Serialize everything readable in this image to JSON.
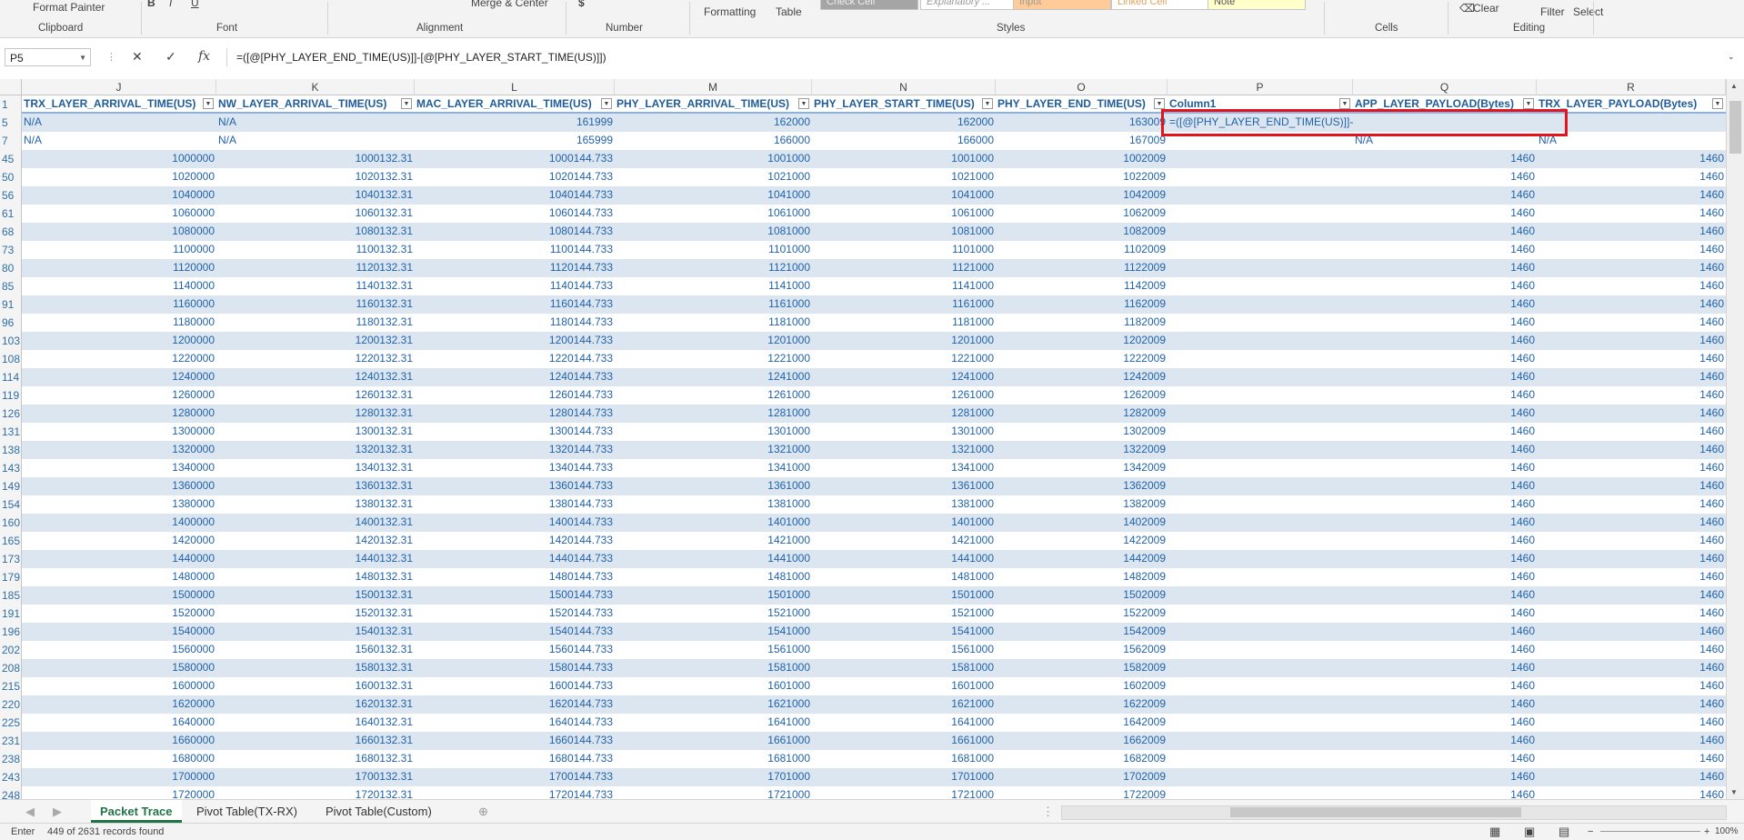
{
  "ribbon": {
    "format_painter": "Format Painter",
    "merge_center": "Merge & Center",
    "formatting": "Formatting",
    "table": "Table",
    "style_check_cell": "Check Cell",
    "style_explanatory": "Explanatory ...",
    "style_input": "Input",
    "style_linked_cell": "Linked Cell",
    "style_note": "Note",
    "clear": "Clear",
    "filter": "Filter",
    "select": "Select",
    "groups": {
      "clipboard": "Clipboard",
      "font": "Font",
      "alignment": "Alignment",
      "number": "Number",
      "styles": "Styles",
      "cells": "Cells",
      "editing": "Editing"
    }
  },
  "formula_bar": {
    "name_box": "P5",
    "formula": "=([@[PHY_LAYER_END_TIME(US)]]-[@[PHY_LAYER_START_TIME(US)]])"
  },
  "columns": [
    "J",
    "K",
    "L",
    "M",
    "N",
    "O",
    "P",
    "Q",
    "R"
  ],
  "header_row": {
    "num": "1",
    "cells": [
      "TRX_LAYER_ARRIVAL_TIME(US)",
      "NW_LAYER_ARRIVAL_TIME(US)",
      "MAC_LAYER_ARRIVAL_TIME(US)",
      "PHY_LAYER_ARRIVAL_TIME(US)",
      "PHY_LAYER_START_TIME(US)",
      "PHY_LAYER_END_TIME(US)",
      "Column1",
      "APP_LAYER_PAYLOAD(Bytes)",
      "TRX_LAYER_PAYLOAD(Bytes)"
    ]
  },
  "rows": [
    {
      "num": "5",
      "cells": [
        "N/A",
        "N/A",
        "161999",
        "162000",
        "162000",
        "163009",
        "=([@[PHY_LAYER_END_TIME(US)]]-[@[PHY_LAYER_START_TIME(US)]])",
        "",
        ""
      ]
    },
    {
      "num": "7",
      "cells": [
        "N/A",
        "N/A",
        "165999",
        "166000",
        "166000",
        "167009",
        "",
        "N/A",
        "N/A"
      ]
    },
    {
      "num": "45",
      "cells": [
        "1000000",
        "1000132.31",
        "1000144.733",
        "1001000",
        "1001000",
        "1002009",
        "",
        "1460",
        "1460"
      ]
    },
    {
      "num": "50",
      "cells": [
        "1020000",
        "1020132.31",
        "1020144.733",
        "1021000",
        "1021000",
        "1022009",
        "",
        "1460",
        "1460"
      ]
    },
    {
      "num": "56",
      "cells": [
        "1040000",
        "1040132.31",
        "1040144.733",
        "1041000",
        "1041000",
        "1042009",
        "",
        "1460",
        "1460"
      ]
    },
    {
      "num": "61",
      "cells": [
        "1060000",
        "1060132.31",
        "1060144.733",
        "1061000",
        "1061000",
        "1062009",
        "",
        "1460",
        "1460"
      ]
    },
    {
      "num": "68",
      "cells": [
        "1080000",
        "1080132.31",
        "1080144.733",
        "1081000",
        "1081000",
        "1082009",
        "",
        "1460",
        "1460"
      ]
    },
    {
      "num": "73",
      "cells": [
        "1100000",
        "1100132.31",
        "1100144.733",
        "1101000",
        "1101000",
        "1102009",
        "",
        "1460",
        "1460"
      ]
    },
    {
      "num": "80",
      "cells": [
        "1120000",
        "1120132.31",
        "1120144.733",
        "1121000",
        "1121000",
        "1122009",
        "",
        "1460",
        "1460"
      ]
    },
    {
      "num": "85",
      "cells": [
        "1140000",
        "1140132.31",
        "1140144.733",
        "1141000",
        "1141000",
        "1142009",
        "",
        "1460",
        "1460"
      ]
    },
    {
      "num": "91",
      "cells": [
        "1160000",
        "1160132.31",
        "1160144.733",
        "1161000",
        "1161000",
        "1162009",
        "",
        "1460",
        "1460"
      ]
    },
    {
      "num": "96",
      "cells": [
        "1180000",
        "1180132.31",
        "1180144.733",
        "1181000",
        "1181000",
        "1182009",
        "",
        "1460",
        "1460"
      ]
    },
    {
      "num": "103",
      "cells": [
        "1200000",
        "1200132.31",
        "1200144.733",
        "1201000",
        "1201000",
        "1202009",
        "",
        "1460",
        "1460"
      ]
    },
    {
      "num": "108",
      "cells": [
        "1220000",
        "1220132.31",
        "1220144.733",
        "1221000",
        "1221000",
        "1222009",
        "",
        "1460",
        "1460"
      ]
    },
    {
      "num": "114",
      "cells": [
        "1240000",
        "1240132.31",
        "1240144.733",
        "1241000",
        "1241000",
        "1242009",
        "",
        "1460",
        "1460"
      ]
    },
    {
      "num": "119",
      "cells": [
        "1260000",
        "1260132.31",
        "1260144.733",
        "1261000",
        "1261000",
        "1262009",
        "",
        "1460",
        "1460"
      ]
    },
    {
      "num": "126",
      "cells": [
        "1280000",
        "1280132.31",
        "1280144.733",
        "1281000",
        "1281000",
        "1282009",
        "",
        "1460",
        "1460"
      ]
    },
    {
      "num": "131",
      "cells": [
        "1300000",
        "1300132.31",
        "1300144.733",
        "1301000",
        "1301000",
        "1302009",
        "",
        "1460",
        "1460"
      ]
    },
    {
      "num": "138",
      "cells": [
        "1320000",
        "1320132.31",
        "1320144.733",
        "1321000",
        "1321000",
        "1322009",
        "",
        "1460",
        "1460"
      ]
    },
    {
      "num": "143",
      "cells": [
        "1340000",
        "1340132.31",
        "1340144.733",
        "1341000",
        "1341000",
        "1342009",
        "",
        "1460",
        "1460"
      ]
    },
    {
      "num": "149",
      "cells": [
        "1360000",
        "1360132.31",
        "1360144.733",
        "1361000",
        "1361000",
        "1362009",
        "",
        "1460",
        "1460"
      ]
    },
    {
      "num": "154",
      "cells": [
        "1380000",
        "1380132.31",
        "1380144.733",
        "1381000",
        "1381000",
        "1382009",
        "",
        "1460",
        "1460"
      ]
    },
    {
      "num": "160",
      "cells": [
        "1400000",
        "1400132.31",
        "1400144.733",
        "1401000",
        "1401000",
        "1402009",
        "",
        "1460",
        "1460"
      ]
    },
    {
      "num": "165",
      "cells": [
        "1420000",
        "1420132.31",
        "1420144.733",
        "1421000",
        "1421000",
        "1422009",
        "",
        "1460",
        "1460"
      ]
    },
    {
      "num": "173",
      "cells": [
        "1440000",
        "1440132.31",
        "1440144.733",
        "1441000",
        "1441000",
        "1442009",
        "",
        "1460",
        "1460"
      ]
    },
    {
      "num": "179",
      "cells": [
        "1480000",
        "1480132.31",
        "1480144.733",
        "1481000",
        "1481000",
        "1482009",
        "",
        "1460",
        "1460"
      ]
    },
    {
      "num": "185",
      "cells": [
        "1500000",
        "1500132.31",
        "1500144.733",
        "1501000",
        "1501000",
        "1502009",
        "",
        "1460",
        "1460"
      ]
    },
    {
      "num": "191",
      "cells": [
        "1520000",
        "1520132.31",
        "1520144.733",
        "1521000",
        "1521000",
        "1522009",
        "",
        "1460",
        "1460"
      ]
    },
    {
      "num": "196",
      "cells": [
        "1540000",
        "1540132.31",
        "1540144.733",
        "1541000",
        "1541000",
        "1542009",
        "",
        "1460",
        "1460"
      ]
    },
    {
      "num": "202",
      "cells": [
        "1560000",
        "1560132.31",
        "1560144.733",
        "1561000",
        "1561000",
        "1562009",
        "",
        "1460",
        "1460"
      ]
    },
    {
      "num": "208",
      "cells": [
        "1580000",
        "1580132.31",
        "1580144.733",
        "1581000",
        "1581000",
        "1582009",
        "",
        "1460",
        "1460"
      ]
    },
    {
      "num": "215",
      "cells": [
        "1600000",
        "1600132.31",
        "1600144.733",
        "1601000",
        "1601000",
        "1602009",
        "",
        "1460",
        "1460"
      ]
    },
    {
      "num": "220",
      "cells": [
        "1620000",
        "1620132.31",
        "1620144.733",
        "1621000",
        "1621000",
        "1622009",
        "",
        "1460",
        "1460"
      ]
    },
    {
      "num": "225",
      "cells": [
        "1640000",
        "1640132.31",
        "1640144.733",
        "1641000",
        "1641000",
        "1642009",
        "",
        "1460",
        "1460"
      ]
    },
    {
      "num": "231",
      "cells": [
        "1660000",
        "1660132.31",
        "1660144.733",
        "1661000",
        "1661000",
        "1662009",
        "",
        "1460",
        "1460"
      ]
    },
    {
      "num": "238",
      "cells": [
        "1680000",
        "1680132.31",
        "1680144.733",
        "1681000",
        "1681000",
        "1682009",
        "",
        "1460",
        "1460"
      ]
    },
    {
      "num": "243",
      "cells": [
        "1700000",
        "1700132.31",
        "1700144.733",
        "1701000",
        "1701000",
        "1702009",
        "",
        "1460",
        "1460"
      ]
    },
    {
      "num": "248",
      "cells": [
        "1720000",
        "1720132.31",
        "1720144.733",
        "1721000",
        "1721000",
        "1722009",
        "",
        "1460",
        "1460"
      ]
    }
  ],
  "sheet_tabs": [
    "Packet Trace",
    "Pivot Table(TX-RX)",
    "Pivot Table(Custom)"
  ],
  "status": {
    "mode": "Enter",
    "records": "449 of 2631 records found",
    "zoom": "100%"
  }
}
